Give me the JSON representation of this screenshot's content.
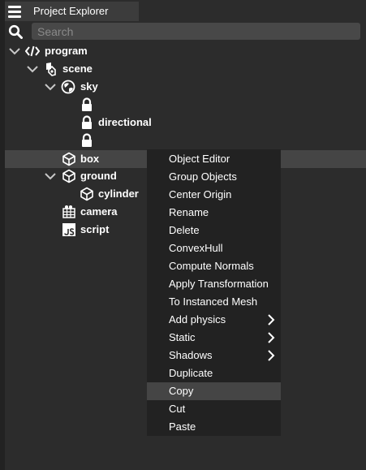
{
  "header": {
    "title": "Project Explorer",
    "menu_icon": "hamburger-menu-icon"
  },
  "search": {
    "placeholder": "Search",
    "value": ""
  },
  "tree": {
    "items": [
      {
        "label": "program",
        "icon": "code-icon",
        "expanded": true
      },
      {
        "label": "scene",
        "icon": "scene-icon",
        "expanded": true
      },
      {
        "label": "sky",
        "icon": "sky-sphere-icon",
        "expanded": true
      },
      {
        "label": "",
        "icon": "lock-icon"
      },
      {
        "label": "directional",
        "icon": "lock-icon"
      },
      {
        "label": "",
        "icon": "lock-icon"
      },
      {
        "label": "box",
        "icon": "cube-icon",
        "selected": true
      },
      {
        "label": "ground",
        "icon": "cube-icon",
        "expanded": true
      },
      {
        "label": "cylinder",
        "icon": "cube-icon"
      },
      {
        "label": "camera",
        "icon": "camera-icon"
      },
      {
        "label": "script",
        "icon": "js-icon"
      }
    ]
  },
  "context_menu": {
    "items": [
      {
        "label": "Object Editor"
      },
      {
        "label": "Group Objects"
      },
      {
        "label": "Center Origin"
      },
      {
        "label": "Rename"
      },
      {
        "label": "Delete"
      },
      {
        "label": "ConvexHull"
      },
      {
        "label": "Compute Normals"
      },
      {
        "label": "Apply Transformation"
      },
      {
        "label": "To Instanced Mesh"
      },
      {
        "label": "Add physics",
        "submenu": true
      },
      {
        "label": "Static",
        "submenu": true
      },
      {
        "label": "Shadows",
        "submenu": true
      },
      {
        "label": "Duplicate"
      },
      {
        "label": "Copy",
        "highlighted": true
      },
      {
        "label": "Cut"
      },
      {
        "label": "Paste"
      }
    ]
  },
  "colors": {
    "panel_bg": "#2c2c2c",
    "header_bg": "#3c3c3c",
    "input_bg": "#484848",
    "menu_bg": "#222222",
    "highlight_bg": "#454545",
    "text": "#ffffff"
  }
}
